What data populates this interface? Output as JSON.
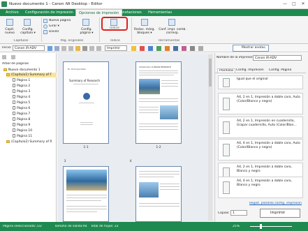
{
  "window": {
    "title": "Nuevo documento 1 - Canon iW Desktop - Editor",
    "min": "—",
    "max": "□",
    "close": "✕"
  },
  "ribbon_tabs": [
    {
      "label": "Archivo"
    },
    {
      "label": "Configuración de impresión"
    },
    {
      "label": "Opciones de impresión"
    },
    {
      "label": "Anotaciones"
    },
    {
      "label": "Herramientas"
    }
  ],
  "ribbon": {
    "capitulos": {
      "btn1": "Capít.\nnuevo",
      "btn2": "Config.\ncapítulo ▾",
      "group": "Capítulos"
    },
    "pag": {
      "nueva": "Nueva página",
      "girar": "Girar ▾",
      "dividir": "Dividir",
      "config": "Config.\npágina ▾",
      "group": "Pág. originales"
    },
    "indice": {
      "btn": "Índice",
      "group": "Índice"
    },
    "herramientas": {
      "reduc": "Reduc. márg.\nbloques ▾",
      "conf": "Conf. impr. comb.\ncorresp.",
      "group": "Herramientas"
    }
  },
  "toolbar": {
    "inicio_label": "Inicio:",
    "printer": "Canon iR-ADV",
    "print_btn": "Imprimir",
    "show_notes": "Mostrar anotac."
  },
  "tree": {
    "header": "Árbol de páginas",
    "root": "Nuevo documento 1",
    "chapter1": "(Capítulo1) Summary of F",
    "pages": [
      "Página 1",
      "Página 2",
      "Página 3",
      "Página 4",
      "Página 5",
      "Página 6",
      "Página 7",
      "Página 8",
      "Página 9",
      "Página 10",
      "Página 11"
    ],
    "chapter2": "(Capítulo2) Summary of R"
  },
  "pages": {
    "p1_label": "1-1",
    "p2_label": "1-2",
    "p3_label": "3",
    "p4_label": "4",
    "p1_title": "Summary of Research",
    "p1_author": "Dr. M.Corporation",
    "p2_title": "Introduction to BRAIN RESEARCH"
  },
  "right": {
    "printer_label": "Nombre de la impresora:",
    "printer_value": "Canon iR-ADV",
    "tabs": [
      "Plantillas",
      "Config. Impresión",
      "Config. Página"
    ],
    "items": [
      "Igual que el original",
      "A4, 2 en 1, Impresión a doble cara, Auto (Color/Blanco y negro)",
      "A4, 2 en 1, Impresión en cuadernillo, Grapar cuadernillo, Auto (Color/Blan...",
      "A4, 4 en 1, Impresión a doble cara, Auto (Color/Blanco y negro)",
      "A4, 2 en 1, Impresión a doble cara, Blanco y negro",
      "A4, 4 en 1, Impresión a doble cara, Blanco y negro"
    ],
    "reset_link": "Regist. plantilla config. impresión",
    "copies_label": "Copias:",
    "copies_value": "1",
    "print_btn": "Imprimir"
  },
  "status": {
    "selected": "Página seleccionada: /22",
    "output_size": "Tamaño de salida:A4",
    "total": "Total de hojas: 22",
    "zoom": "25%"
  },
  "colors": {
    "accent": "#1e8a4f",
    "highlight": "#e02020"
  }
}
